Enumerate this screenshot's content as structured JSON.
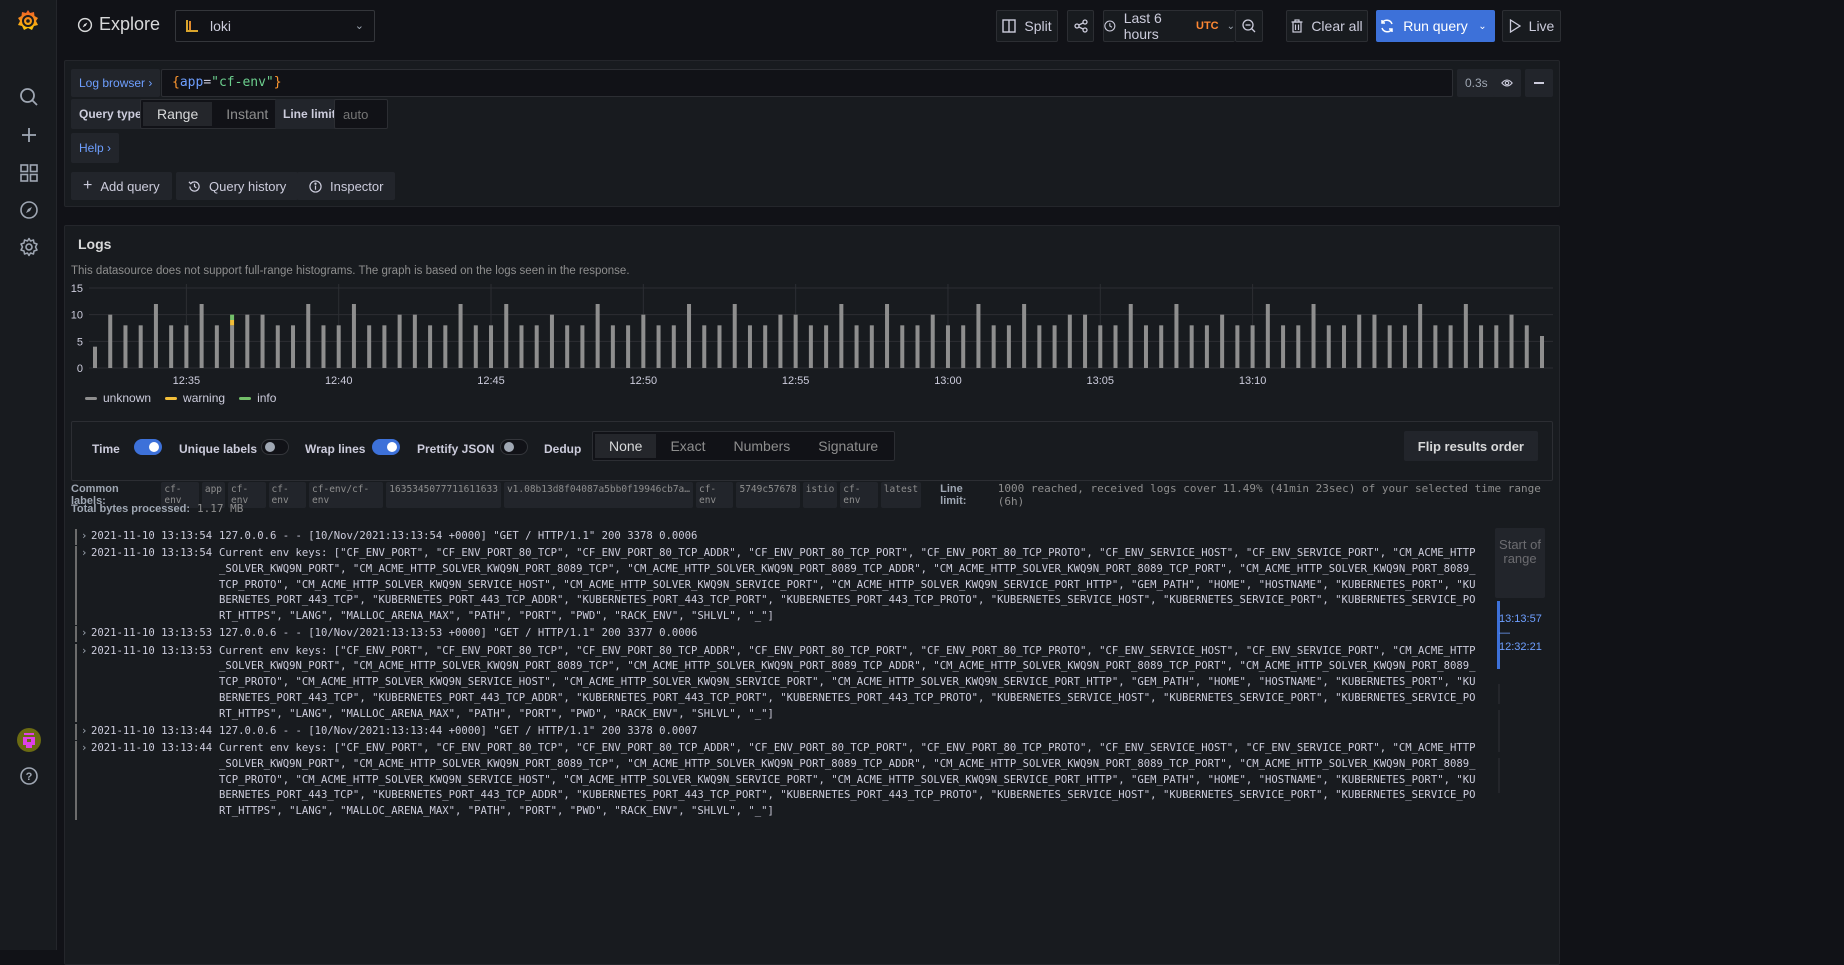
{
  "sidebar": {
    "logo": "grafana-logo",
    "items": [
      {
        "icon": "search-icon",
        "label": "Search"
      },
      {
        "icon": "plus-icon",
        "label": "Create"
      },
      {
        "icon": "dashboards-icon",
        "label": "Dashboards"
      },
      {
        "icon": "compass-icon",
        "label": "Explore"
      },
      {
        "icon": "gear-icon",
        "label": "Configuration"
      }
    ],
    "bottom": [
      {
        "icon": "avatar",
        "label": "Profile"
      },
      {
        "icon": "help-icon",
        "label": "Help"
      }
    ]
  },
  "header": {
    "title": "Explore",
    "datasource": "loki",
    "split_label": "Split",
    "time_range": "Last 6 hours",
    "timezone": "UTC",
    "clear_label": "Clear all",
    "run_label": "Run query",
    "live_label": "Live"
  },
  "query": {
    "log_browser_label": "Log browser",
    "expr": {
      "open": "{",
      "key": "app",
      "eq": "=",
      "value": "\"cf-env\"",
      "close": "}"
    },
    "duration": "0.3s",
    "query_type_label": "Query type",
    "query_types": [
      "Range",
      "Instant"
    ],
    "query_type_selected": "Range",
    "line_limit_label": "Line limit",
    "line_limit_placeholder": "auto",
    "help_label": "Help",
    "add_query_label": "Add query",
    "history_label": "Query history",
    "inspector_label": "Inspector"
  },
  "logs": {
    "title": "Logs",
    "histogram_note": "This datasource does not support full-range histograms. The graph is based on the logs seen in the response.",
    "options": {
      "time_label": "Time",
      "time_on": true,
      "unique_labels_label": "Unique labels",
      "unique_labels_on": false,
      "wrap_lines_label": "Wrap lines",
      "wrap_lines_on": true,
      "prettify_json_label": "Prettify JSON",
      "prettify_json_on": false,
      "dedup_label": "Dedup",
      "dedup_options": [
        "None",
        "Exact",
        "Numbers",
        "Signature"
      ],
      "dedup_selected": "None",
      "flip_label": "Flip results order"
    },
    "common_labels_label": "Common labels:",
    "common_labels": [
      "cf-env",
      "app",
      "cf-env",
      "cf-env",
      "cf-env/cf-env",
      "1635345077711611633",
      "v1.08b13d8f04087a5bb0f19946cb7a…",
      "cf-env",
      "5749c57678",
      "istio",
      "cf-env",
      "latest"
    ],
    "line_limit_label": "Line limit:",
    "line_limit_text": "1000 reached, received logs cover 11.49% (41min 23sec) of your selected time range (6h)",
    "total_bytes_label": "Total bytes processed:",
    "total_bytes": "1.17 MB",
    "start_of_range_label": "Start of range",
    "range_from": "13:13:57",
    "range_dash": "—",
    "range_to": "12:32:21",
    "rows": [
      {
        "ts": "2021-11-10 13:13:54",
        "msg": "127.0.0.6 - - [10/Nov/2021:13:13:54 +0000] \"GET / HTTP/1.1\" 200 3378 0.0006"
      },
      {
        "ts": "2021-11-10 13:13:54",
        "msg": "Current env keys: [\"CF_ENV_PORT\", \"CF_ENV_PORT_80_TCP\", \"CF_ENV_PORT_80_TCP_ADDR\", \"CF_ENV_PORT_80_TCP_PORT\", \"CF_ENV_PORT_80_TCP_PROTO\", \"CF_ENV_SERVICE_HOST\", \"CF_ENV_SERVICE_PORT\", \"CM_ACME_HTTP_SOLVER_KWQ9N_PORT\", \"CM_ACME_HTTP_SOLVER_KWQ9N_PORT_8089_TCP\", \"CM_ACME_HTTP_SOLVER_KWQ9N_PORT_8089_TCP_ADDR\", \"CM_ACME_HTTP_SOLVER_KWQ9N_PORT_8089_TCP_PORT\", \"CM_ACME_HTTP_SOLVER_KWQ9N_PORT_8089_TCP_PROTO\", \"CM_ACME_HTTP_SOLVER_KWQ9N_SERVICE_HOST\", \"CM_ACME_HTTP_SOLVER_KWQ9N_SERVICE_PORT\", \"CM_ACME_HTTP_SOLVER_KWQ9N_SERVICE_PORT_HTTP\", \"GEM_PATH\", \"HOME\", \"HOSTNAME\", \"KUBERNETES_PORT\", \"KUBERNETES_PORT_443_TCP\", \"KUBERNETES_PORT_443_TCP_ADDR\", \"KUBERNETES_PORT_443_TCP_PORT\", \"KUBERNETES_PORT_443_TCP_PROTO\", \"KUBERNETES_SERVICE_HOST\", \"KUBERNETES_SERVICE_PORT\", \"KUBERNETES_SERVICE_PORT_HTTPS\", \"LANG\", \"MALLOC_ARENA_MAX\", \"PATH\", \"PORT\", \"PWD\", \"RACK_ENV\", \"SHLVL\", \"_\"]"
      },
      {
        "ts": "2021-11-10 13:13:53",
        "msg": "127.0.0.6 - - [10/Nov/2021:13:13:53 +0000] \"GET / HTTP/1.1\" 200 3377 0.0006"
      },
      {
        "ts": "2021-11-10 13:13:53",
        "msg": "Current env keys: [\"CF_ENV_PORT\", \"CF_ENV_PORT_80_TCP\", \"CF_ENV_PORT_80_TCP_ADDR\", \"CF_ENV_PORT_80_TCP_PORT\", \"CF_ENV_PORT_80_TCP_PROTO\", \"CF_ENV_SERVICE_HOST\", \"CF_ENV_SERVICE_PORT\", \"CM_ACME_HTTP_SOLVER_KWQ9N_PORT\", \"CM_ACME_HTTP_SOLVER_KWQ9N_PORT_8089_TCP\", \"CM_ACME_HTTP_SOLVER_KWQ9N_PORT_8089_TCP_ADDR\", \"CM_ACME_HTTP_SOLVER_KWQ9N_PORT_8089_TCP_PORT\", \"CM_ACME_HTTP_SOLVER_KWQ9N_PORT_8089_TCP_PROTO\", \"CM_ACME_HTTP_SOLVER_KWQ9N_SERVICE_HOST\", \"CM_ACME_HTTP_SOLVER_KWQ9N_SERVICE_PORT\", \"CM_ACME_HTTP_SOLVER_KWQ9N_SERVICE_PORT_HTTP\", \"GEM_PATH\", \"HOME\", \"HOSTNAME\", \"KUBERNETES_PORT\", \"KUBERNETES_PORT_443_TCP\", \"KUBERNETES_PORT_443_TCP_ADDR\", \"KUBERNETES_PORT_443_TCP_PORT\", \"KUBERNETES_PORT_443_TCP_PROTO\", \"KUBERNETES_SERVICE_HOST\", \"KUBERNETES_SERVICE_PORT\", \"KUBERNETES_SERVICE_PORT_HTTPS\", \"LANG\", \"MALLOC_ARENA_MAX\", \"PATH\", \"PORT\", \"PWD\", \"RACK_ENV\", \"SHLVL\", \"_\"]"
      },
      {
        "ts": "2021-11-10 13:13:44",
        "msg": "127.0.0.6 - - [10/Nov/2021:13:13:44 +0000] \"GET / HTTP/1.1\" 200 3378 0.0007"
      },
      {
        "ts": "2021-11-10 13:13:44",
        "msg": "Current env keys: [\"CF_ENV_PORT\", \"CF_ENV_PORT_80_TCP\", \"CF_ENV_PORT_80_TCP_ADDR\", \"CF_ENV_PORT_80_TCP_PORT\", \"CF_ENV_PORT_80_TCP_PROTO\", \"CF_ENV_SERVICE_HOST\", \"CF_ENV_SERVICE_PORT\", \"CM_ACME_HTTP_SOLVER_KWQ9N_PORT\", \"CM_ACME_HTTP_SOLVER_KWQ9N_PORT_8089_TCP\", \"CM_ACME_HTTP_SOLVER_KWQ9N_PORT_8089_TCP_ADDR\", \"CM_ACME_HTTP_SOLVER_KWQ9N_PORT_8089_TCP_PORT\", \"CM_ACME_HTTP_SOLVER_KWQ9N_PORT_8089_TCP_PROTO\", \"CM_ACME_HTTP_SOLVER_KWQ9N_SERVICE_HOST\", \"CM_ACME_HTTP_SOLVER_KWQ9N_SERVICE_PORT\", \"CM_ACME_HTTP_SOLVER_KWQ9N_SERVICE_PORT_HTTP\", \"GEM_PATH\", \"HOME\", \"HOSTNAME\", \"KUBERNETES_PORT\", \"KUBERNETES_PORT_443_TCP\", \"KUBERNETES_PORT_443_TCP_ADDR\", \"KUBERNETES_PORT_443_TCP_PORT\", \"KUBERNETES_PORT_443_TCP_PROTO\", \"KUBERNETES_SERVICE_HOST\", \"KUBERNETES_SERVICE_PORT\", \"KUBERNETES_SERVICE_PORT_HTTPS\", \"LANG\", \"MALLOC_ARENA_MAX\", \"PATH\", \"PORT\", \"PWD\", \"RACK_ENV\", \"SHLVL\", \"_\"]"
      }
    ]
  },
  "colors": {
    "accent": "#3d71d9",
    "unknown": "#8e8e8e",
    "warning": "#f2be39",
    "info": "#73bf69",
    "utc": "#ff8833"
  },
  "chart_data": {
    "type": "bar",
    "stacked": true,
    "title": "",
    "xlabel": "",
    "ylabel": "",
    "ylim": [
      0,
      15
    ],
    "yticks": [
      "0",
      "5",
      "10",
      "15"
    ],
    "xticks": [
      "12:35",
      "12:40",
      "12:45",
      "12:50",
      "12:55",
      "13:00",
      "13:05",
      "13:10"
    ],
    "grid": true,
    "legend": "bottom-left",
    "x_start": "12:32:00",
    "x_step_seconds": 30,
    "series": [
      {
        "name": "unknown",
        "color": "#8e8e8e",
        "values": [
          4,
          10,
          8,
          8,
          12,
          8,
          8,
          12,
          8,
          8,
          10,
          10,
          8,
          8,
          12,
          8,
          8,
          12,
          8,
          8,
          10,
          10,
          8,
          8,
          12,
          8,
          8,
          12,
          8,
          8,
          10,
          8,
          8,
          12,
          8,
          8,
          10,
          8,
          8,
          12,
          8,
          8,
          12,
          8,
          8,
          10,
          10,
          8,
          8,
          12,
          8,
          8,
          12,
          8,
          8,
          10,
          8,
          8,
          12,
          8,
          8,
          12,
          8,
          8,
          10,
          10,
          8,
          8,
          12,
          8,
          8,
          12,
          8,
          8,
          10,
          8,
          8,
          12,
          8,
          8,
          12,
          8,
          8,
          10,
          10,
          8,
          8,
          12,
          8,
          8,
          12,
          8,
          8,
          10,
          8,
          6
        ]
      },
      {
        "name": "warning",
        "color": "#f2be39",
        "values": [
          0,
          0,
          0,
          0,
          0,
          0,
          0,
          0,
          0,
          1,
          0,
          0,
          0,
          0,
          0,
          0,
          0,
          0,
          0,
          0,
          0,
          0,
          0,
          0,
          0,
          0,
          0,
          0,
          0,
          0,
          0,
          0,
          0,
          0,
          0,
          0,
          0,
          0,
          0,
          0,
          0,
          0,
          0,
          0,
          0,
          0,
          0,
          0,
          0,
          0,
          0,
          0,
          0,
          0,
          0,
          0,
          0,
          0,
          0,
          0,
          0,
          0,
          0,
          0,
          0,
          0,
          0,
          0,
          0,
          0,
          0,
          0,
          0,
          0,
          0,
          0,
          0,
          0,
          0,
          0,
          0,
          0,
          0,
          0,
          0,
          0,
          0,
          0,
          0,
          0,
          0,
          0,
          0,
          0,
          0,
          0
        ]
      },
      {
        "name": "info",
        "color": "#73bf69",
        "values": [
          0,
          0,
          0,
          0,
          0,
          0,
          0,
          0,
          0,
          1,
          0,
          0,
          0,
          0,
          0,
          0,
          0,
          0,
          0,
          0,
          0,
          0,
          0,
          0,
          0,
          0,
          0,
          0,
          0,
          0,
          0,
          0,
          0,
          0,
          0,
          0,
          0,
          0,
          0,
          0,
          0,
          0,
          0,
          0,
          0,
          0,
          0,
          0,
          0,
          0,
          0,
          0,
          0,
          0,
          0,
          0,
          0,
          0,
          0,
          0,
          0,
          0,
          0,
          0,
          0,
          0,
          0,
          0,
          0,
          0,
          0,
          0,
          0,
          0,
          0,
          0,
          0,
          0,
          0,
          0,
          0,
          0,
          0,
          0,
          0,
          0,
          0,
          0,
          0,
          0,
          0,
          0,
          0,
          0,
          0,
          0
        ]
      }
    ]
  }
}
